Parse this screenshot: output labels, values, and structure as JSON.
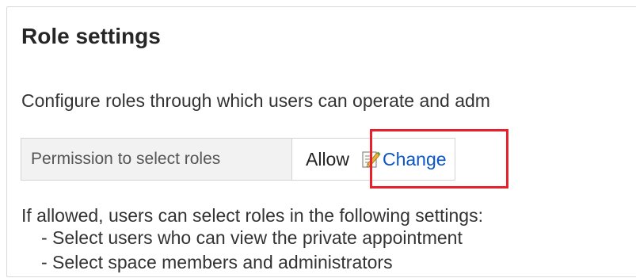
{
  "page": {
    "title": "Role settings",
    "description": "Configure roles through which users can operate and adm"
  },
  "setting": {
    "label": "Permission to select roles",
    "value": "Allow",
    "change_label": "Change",
    "change_icon": "edit-pencil-icon"
  },
  "info": {
    "text": "If allowed, users can select roles in the following settings:",
    "items": [
      "- Select users who can view the private appointment",
      "- Select space members and administrators"
    ]
  },
  "colors": {
    "link": "#0a55c8",
    "highlight": "#e8202a",
    "label_background": "#f2f2f2"
  }
}
